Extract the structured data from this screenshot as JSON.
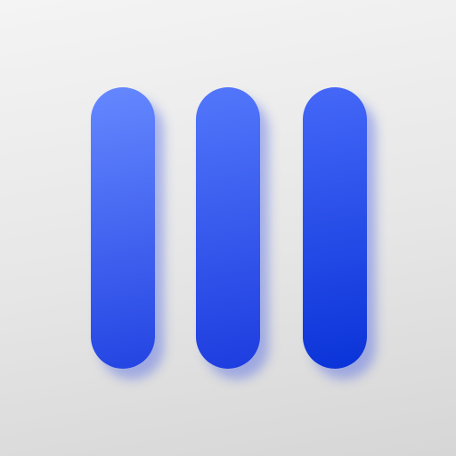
{
  "icon": {
    "glyph": "three-vertical-bars-icon",
    "bar_count": 3,
    "background_colors": [
      "#f4f4f4",
      "#d6d6d6"
    ],
    "bar_gradient": [
      [
        "#6588ff",
        "#2444e2"
      ],
      [
        "#5277fb",
        "#1d3ddf"
      ],
      [
        "#4568f8",
        "#0a33d8"
      ]
    ],
    "shadow_color": "#2846e6"
  }
}
